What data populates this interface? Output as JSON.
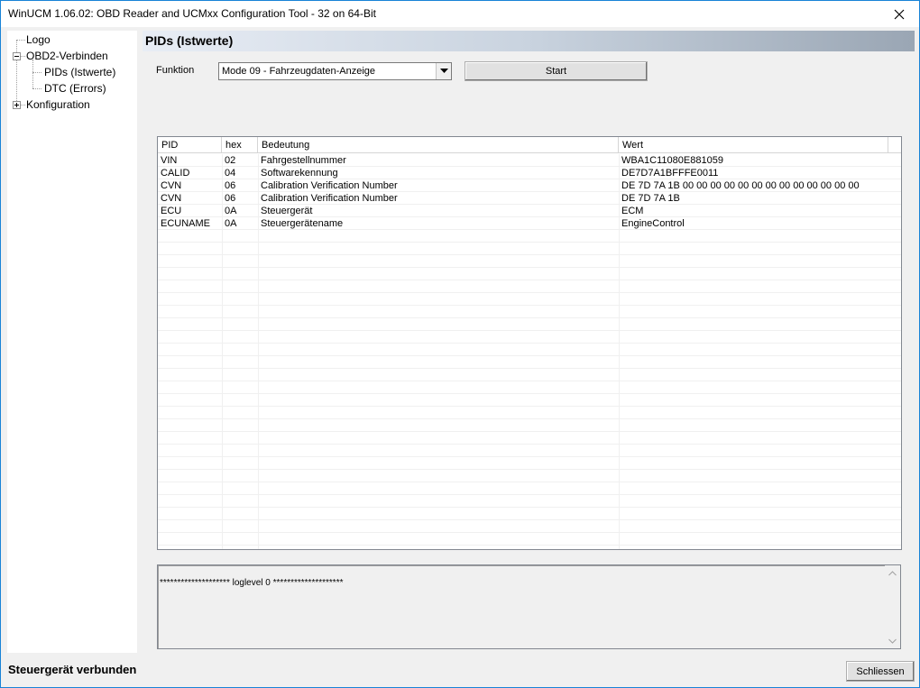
{
  "window": {
    "title": "WinUCM 1.06.02: OBD Reader and UCMxx Configuration Tool - 32 on 64-Bit"
  },
  "tree": {
    "logo": "Logo",
    "obd2": "OBD2-Verbinden",
    "pids": "PIDs (Istwerte)",
    "dtc": "DTC (Errors)",
    "konfig": "Konfiguration"
  },
  "panel": {
    "title": "PIDs (Istwerte)",
    "funktion_label": "Funktion",
    "funktion_value": "Mode 09 - Fahrzeugdaten-Anzeige",
    "start_label": "Start"
  },
  "table": {
    "headers": [
      "PID",
      "hex",
      "Bedeutung",
      "Wert"
    ],
    "rows": [
      [
        "VIN",
        "02",
        "Fahrgestellnummer",
        "WBA1C11080E881059"
      ],
      [
        "CALID",
        "04",
        "Softwarekennung",
        "DE7D7A1BFFFE0011"
      ],
      [
        "CVN",
        "06",
        "Calibration Verification Number",
        "DE 7D 7A 1B 00 00 00 00 00 00 00 00 00 00 00 00 00"
      ],
      [
        "CVN",
        "06",
        "Calibration Verification Number",
        "DE 7D 7A 1B"
      ],
      [
        "ECU",
        "0A",
        "Steuergerät",
        "ECM"
      ],
      [
        "ECUNAME",
        "0A",
        "Steuergerätename",
        "EngineControl"
      ]
    ]
  },
  "log": {
    "text": "******************** loglevel 0 ********************"
  },
  "footer": {
    "status": "Steuergerät verbunden",
    "close_label": "Schliessen"
  },
  "icons": {
    "close": "close-icon",
    "dropdown": "chevron-down-icon",
    "expand": "tree-expander-icon"
  }
}
